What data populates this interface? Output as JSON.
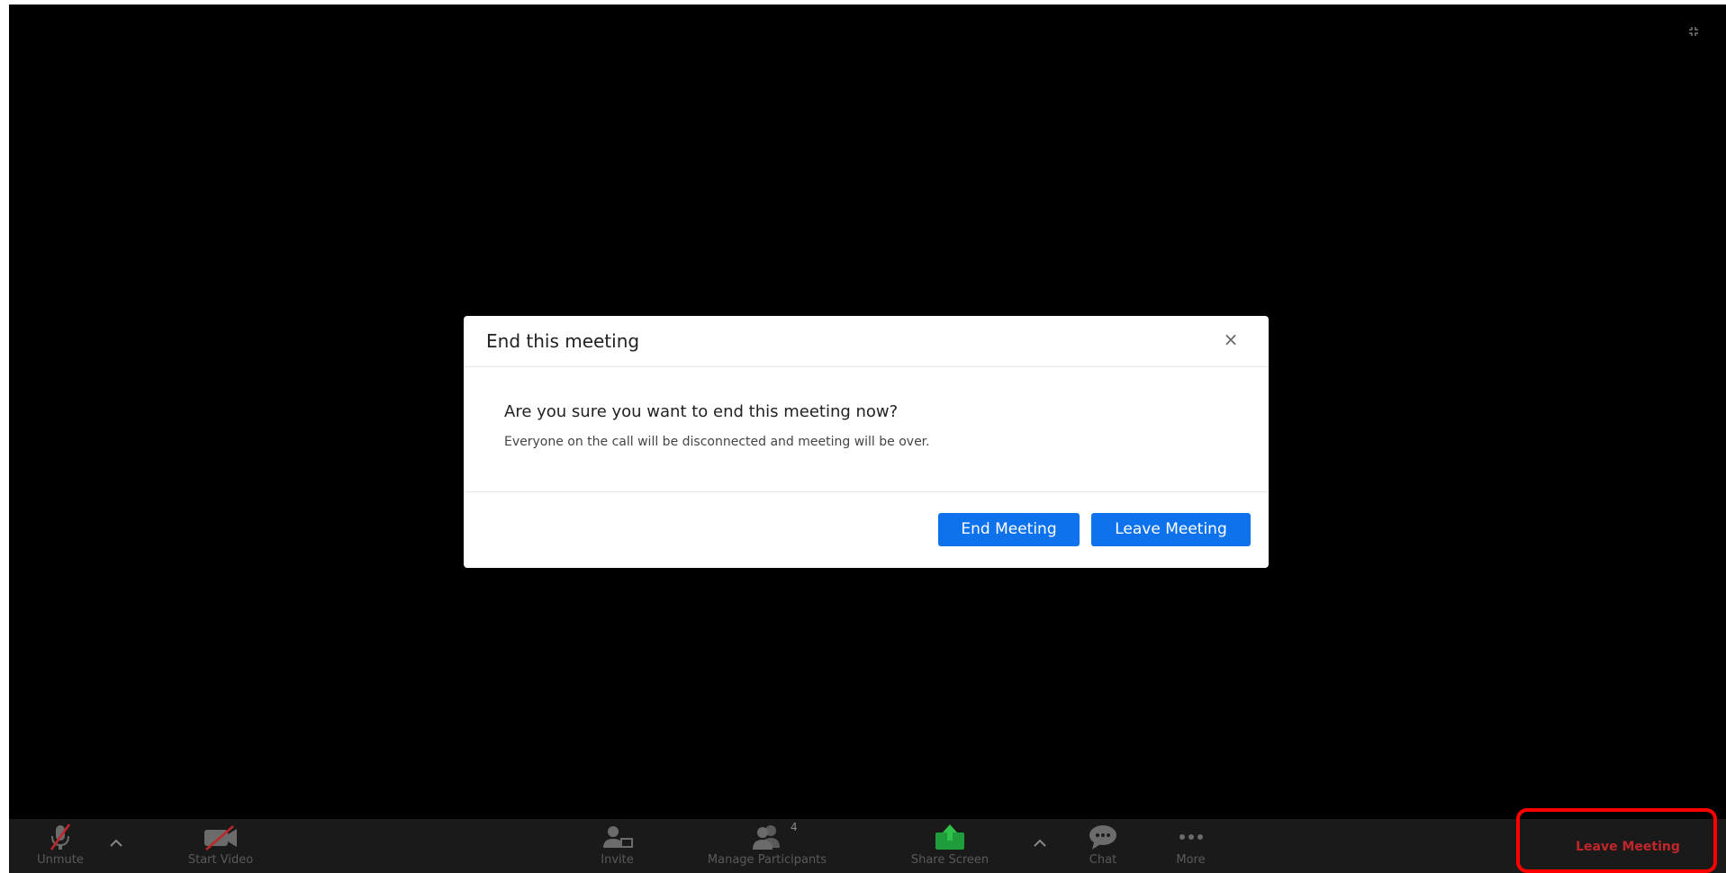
{
  "dialog": {
    "title": "End this meeting",
    "close_glyph": "×",
    "question": "Are you sure you want to end this meeting now?",
    "detail": "Everyone on the call will be disconnected and meeting will be over.",
    "end_button": "End Meeting",
    "leave_button": "Leave Meeting"
  },
  "toolbar": {
    "unmute": "Unmute",
    "start_video": "Start Video",
    "invite": "Invite",
    "manage_participants": "Manage Participants",
    "participant_count": "4",
    "share_screen": "Share Screen",
    "chat": "Chat",
    "more": "More",
    "leave_meeting": "Leave Meeting"
  },
  "colors": {
    "accent": "#0e72ed",
    "leave_red": "#c0262a",
    "share_green": "#1f9d3a",
    "highlight": "#ff0000"
  }
}
